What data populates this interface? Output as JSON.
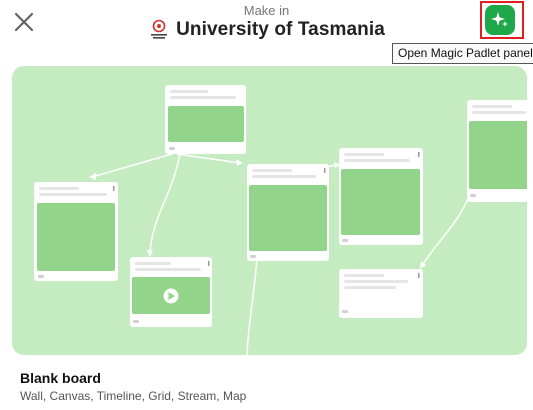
{
  "header": {
    "make_in_label": "Make in",
    "org_name": "University of Tasmania",
    "close_icon": "close-icon",
    "magic_icon": "sparkles-icon"
  },
  "tooltip": {
    "text": "Open Magic Padlet panel"
  },
  "template": {
    "title": "Blank board",
    "formats": "Wall, Canvas, Timeline, Grid, Stream, Map"
  },
  "colors": {
    "preview_background": "#c5ecc0",
    "card_image": "#92d58a",
    "magic_button": "#1fa84a",
    "highlight": "#e02020"
  }
}
